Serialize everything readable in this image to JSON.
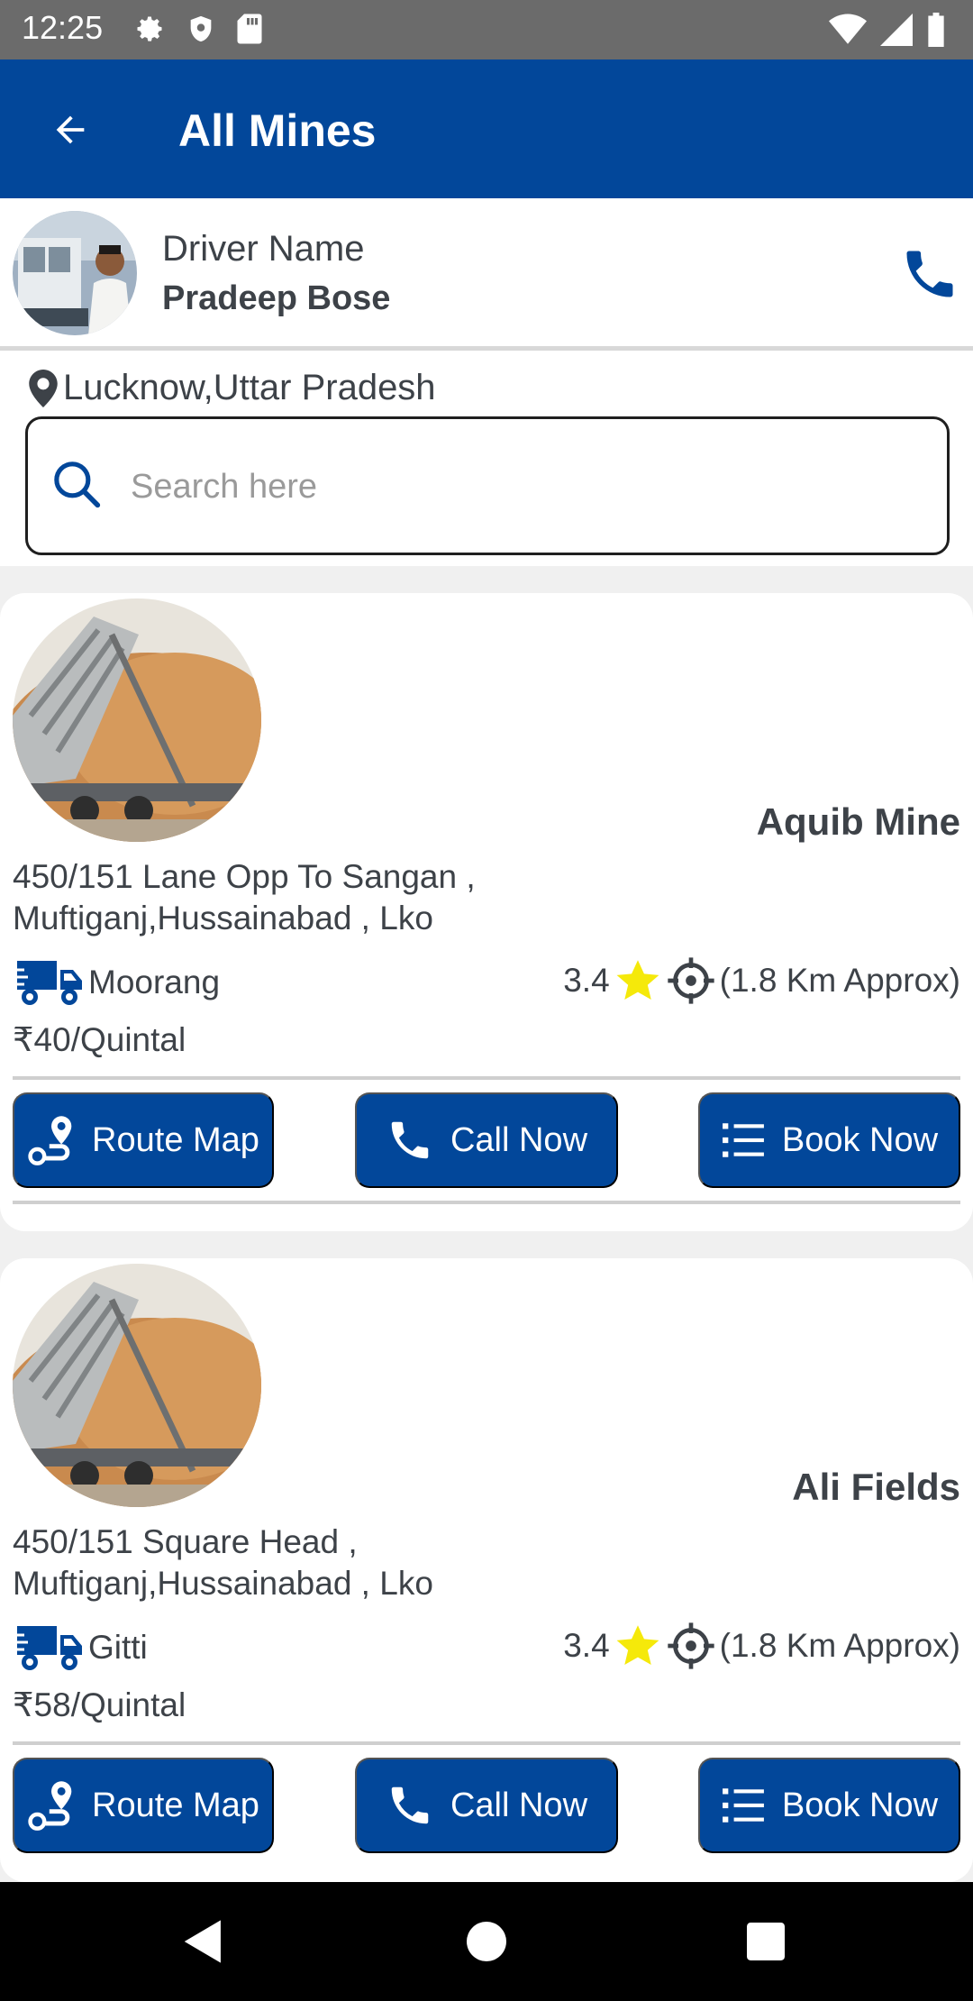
{
  "status_bar": {
    "time": "12:25"
  },
  "app_bar": {
    "title": "All Mines"
  },
  "driver": {
    "label": "Driver Name",
    "name": "Pradeep Bose"
  },
  "location": {
    "text": "Lucknow,Uttar Pradesh"
  },
  "search": {
    "placeholder": "Search here",
    "value": ""
  },
  "buttons": {
    "route_map": "Route Map",
    "call_now": "Call Now",
    "book_now": "Book Now"
  },
  "mines": [
    {
      "name": "Aquib Mine",
      "address": "450/151 Lane Opp To Sangan , Muftiganj,Hussainabad , Lko",
      "material": "Moorang",
      "rating": "3.4",
      "distance": "(1.8 Km Approx)",
      "price": "₹40/Quintal"
    },
    {
      "name": "Ali Fields",
      "address": "450/151 Square Head , Muftiganj,Hussainabad , Lko",
      "material": "Gitti",
      "rating": "3.4",
      "distance": "(1.8 Km Approx)",
      "price": "₹58/Quintal"
    }
  ],
  "colors": {
    "primary": "#02479a",
    "star": "#f5e90a",
    "status_bar": "#6b6b6b"
  },
  "icons": [
    "back-arrow-icon",
    "phone-icon",
    "map-pin-icon",
    "search-icon",
    "truck-icon",
    "star-icon",
    "crosshair-icon",
    "route-icon",
    "list-icon"
  ]
}
